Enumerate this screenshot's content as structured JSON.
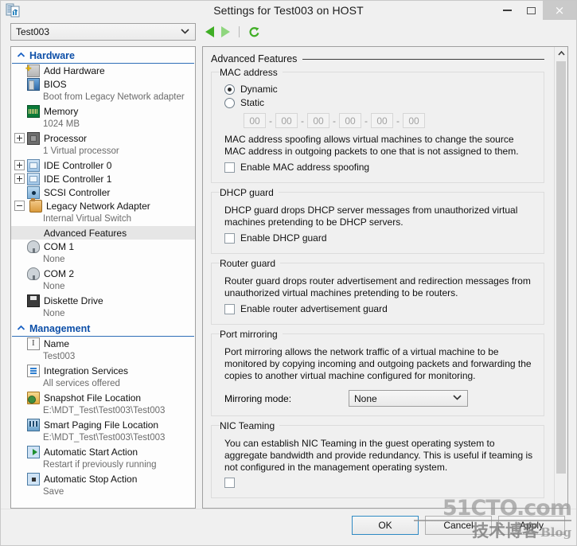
{
  "window": {
    "title": "Settings for Test003 on HOST",
    "icon": "settings-document-icon",
    "minimize_label": "–",
    "maximize_label": "□",
    "close_label": "×"
  },
  "toolbar": {
    "vm_selector_value": "Test003",
    "vm_selector_caret": "⌄",
    "back_icon": "back-arrow-icon",
    "forward_icon": "forward-arrow-icon",
    "refresh_icon": "refresh-icon"
  },
  "sidebar": {
    "sections": [
      {
        "title": "Hardware",
        "chevron": "«",
        "items": [
          {
            "label": "Add Hardware",
            "icon": "add-hardware-icon",
            "icon_class": "ic-add",
            "expander": "none",
            "sub": null,
            "selected": false
          },
          {
            "label": "BIOS",
            "icon": "bios-icon",
            "icon_class": "ic-bios",
            "expander": "none",
            "sub": "Boot from Legacy Network adapter",
            "selected": false
          },
          {
            "label": "Memory",
            "icon": "memory-icon",
            "icon_class": "ic-mem",
            "expander": "none",
            "sub": "1024 MB",
            "selected": false
          },
          {
            "label": "Processor",
            "icon": "processor-icon",
            "icon_class": "ic-cpu",
            "expander": "plus",
            "sub": "1 Virtual processor",
            "selected": false
          },
          {
            "label": "IDE Controller 0",
            "icon": "ide-controller-icon",
            "icon_class": "ic-ide",
            "expander": "plus",
            "sub": null,
            "selected": false
          },
          {
            "label": "IDE Controller 1",
            "icon": "ide-controller-icon",
            "icon_class": "ic-ide",
            "expander": "plus",
            "sub": null,
            "selected": false
          },
          {
            "label": "SCSI Controller",
            "icon": "scsi-controller-icon",
            "icon_class": "ic-scsi",
            "expander": "none",
            "sub": null,
            "selected": false
          },
          {
            "label": "Legacy Network Adapter",
            "icon": "network-adapter-icon",
            "icon_class": "ic-nic",
            "expander": "minus",
            "sub": "Internal Virtual Switch",
            "selected": false
          },
          {
            "label": "Advanced Features",
            "icon": "none",
            "icon_class": "",
            "expander": "child",
            "sub": null,
            "selected": true
          },
          {
            "label": "COM 1",
            "icon": "com-port-icon",
            "icon_class": "ic-com",
            "expander": "none",
            "sub": "None",
            "selected": false
          },
          {
            "label": "COM 2",
            "icon": "com-port-icon",
            "icon_class": "ic-com",
            "expander": "none",
            "sub": "None",
            "selected": false
          },
          {
            "label": "Diskette Drive",
            "icon": "diskette-drive-icon",
            "icon_class": "ic-disk",
            "expander": "none",
            "sub": "None",
            "selected": false
          }
        ]
      },
      {
        "title": "Management",
        "chevron": "«",
        "items": [
          {
            "label": "Name",
            "icon": "name-icon",
            "icon_class": "ic-name",
            "expander": "none",
            "sub": "Test003",
            "selected": false
          },
          {
            "label": "Integration Services",
            "icon": "integration-services-icon",
            "icon_class": "ic-integ",
            "expander": "none",
            "sub": "All services offered",
            "selected": false
          },
          {
            "label": "Snapshot File Location",
            "icon": "snapshot-folder-icon",
            "icon_class": "ic-snap",
            "expander": "none",
            "sub": "E:\\MDT_Test\\Test003\\Test003",
            "selected": false
          },
          {
            "label": "Smart Paging File Location",
            "icon": "smart-paging-icon",
            "icon_class": "ic-page",
            "expander": "none",
            "sub": "E:\\MDT_Test\\Test003\\Test003",
            "selected": false
          },
          {
            "label": "Automatic Start Action",
            "icon": "automatic-start-icon",
            "icon_class": "ic-start",
            "expander": "none",
            "sub": "Restart if previously running",
            "selected": false
          },
          {
            "label": "Automatic Stop Action",
            "icon": "automatic-stop-icon",
            "icon_class": "ic-stop",
            "expander": "none",
            "sub": "Save",
            "selected": false
          }
        ]
      }
    ]
  },
  "pane": {
    "title": "Advanced Features",
    "mac_address": {
      "legend": "MAC address",
      "dynamic_label": "Dynamic",
      "static_label": "Static",
      "selected": "Dynamic",
      "octets": [
        "00",
        "00",
        "00",
        "00",
        "00",
        "00"
      ],
      "separator": "-",
      "description": "MAC address spoofing allows virtual machines to change the source MAC address in outgoing packets to one that is not assigned to them.",
      "spoofing_checkbox_label": "Enable MAC address spoofing",
      "spoofing_checked": false
    },
    "dhcp_guard": {
      "legend": "DHCP guard",
      "description": "DHCP guard drops DHCP server messages from unauthorized virtual machines pretending to be DHCP servers.",
      "checkbox_label": "Enable DHCP guard",
      "checked": false
    },
    "router_guard": {
      "legend": "Router guard",
      "description": "Router guard drops router advertisement and redirection messages from unauthorized virtual machines pretending to be routers.",
      "checkbox_label": "Enable router advertisement guard",
      "checked": false
    },
    "port_mirroring": {
      "legend": "Port mirroring",
      "description": "Port mirroring allows the network traffic of a virtual machine to be monitored by copying incoming and outgoing packets and forwarding the copies to another virtual machine configured for monitoring.",
      "mode_label": "Mirroring mode:",
      "mode_value": "None",
      "mode_caret": "⌄"
    },
    "nic_teaming": {
      "legend": "NIC Teaming",
      "description": "You can establish NIC Teaming in the guest operating system to aggregate bandwidth and provide redundancy. This is useful if teaming is not configured in the management operating system."
    },
    "scrollbar": {
      "up_arrow": "⌃",
      "down_arrow": "⌄"
    }
  },
  "footer": {
    "ok_label": "OK",
    "cancel_label": "Cancel",
    "apply_label": "Apply"
  },
  "watermark": {
    "top": "51CTO.com",
    "bottom_cn": "技术博客",
    "bottom_en": "Blog"
  },
  "colors": {
    "section_header": "#0d4fa8",
    "accent_green": "#3fae25",
    "default_button_border": "#2f8ac4",
    "selection_bg": "#e6e6e6"
  }
}
